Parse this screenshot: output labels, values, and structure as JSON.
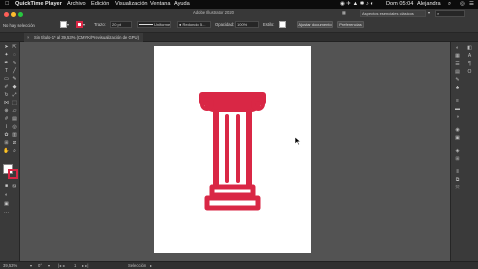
{
  "menubar": {
    "app": "QuickTime Player",
    "menus": [
      "Archivo",
      "Edición",
      "Visualización",
      "Ventana",
      "Ayuda"
    ],
    "datetime": "Dom 05:04",
    "user": "Alejandra"
  },
  "window": {
    "title": "Adobe Illustrator 2020"
  },
  "control_bar": {
    "selection_label": "No hay selección",
    "stroke_label": "Trazo:",
    "stroke_value": "20 pt",
    "brush_profile": "Uniforme",
    "brush_style": "Redondo 5...",
    "opacity_label": "Opacidad:",
    "opacity_value": "100%",
    "style_label": "Estilo:",
    "doc_setup_button": "Ajustar documento",
    "preferences_button": "Preferencias",
    "workspace": "Aspectos esenciales clásicos",
    "search_placeholder": ""
  },
  "document_tab": {
    "title": "Sin título-1* al 39,53% (CMYK/Previsualización de GPU)"
  },
  "toolbar": {
    "tools": [
      "selection-tool",
      "direct-selection-tool",
      "magic-wand-tool",
      "pen-tool",
      "type-tool",
      "line-tool",
      "rectangle-tool",
      "paintbrush-tool",
      "pencil-tool",
      "eraser-tool",
      "rotate-tool",
      "scale-tool",
      "width-tool",
      "free-transform-tool",
      "shape-builder-tool",
      "perspective-tool",
      "mesh-tool",
      "gradient-tool",
      "eyedropper-tool",
      "blend-tool",
      "symbol-sprayer-tool",
      "column-graph-tool",
      "artboard-tool",
      "slice-tool",
      "hand-tool",
      "zoom-tool"
    ]
  },
  "artwork": {
    "description_color": "#d92745"
  },
  "status_bar": {
    "zoom": "39,53%",
    "angle": "0°",
    "artboard_num": "1",
    "tool": "Selección"
  },
  "colors": {
    "accent": "#d92745",
    "ui_dark": "#383838",
    "canvas": "#535353"
  }
}
